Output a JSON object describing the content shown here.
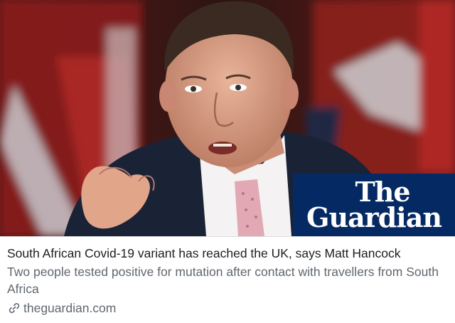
{
  "preview": {
    "image_logo_line1": "The",
    "image_logo_line2": "Guardian",
    "headline": "South African Covid-19 variant has reached the UK, says Matt Hancock",
    "description": "Two people tested positive for mutation after contact with travellers from South Africa",
    "domain": "theguardian.com",
    "icons": {
      "domain": "link-icon"
    },
    "colors": {
      "logo_bg": "#052962",
      "headline": "#1c1e21",
      "secondary": "#606770"
    }
  }
}
